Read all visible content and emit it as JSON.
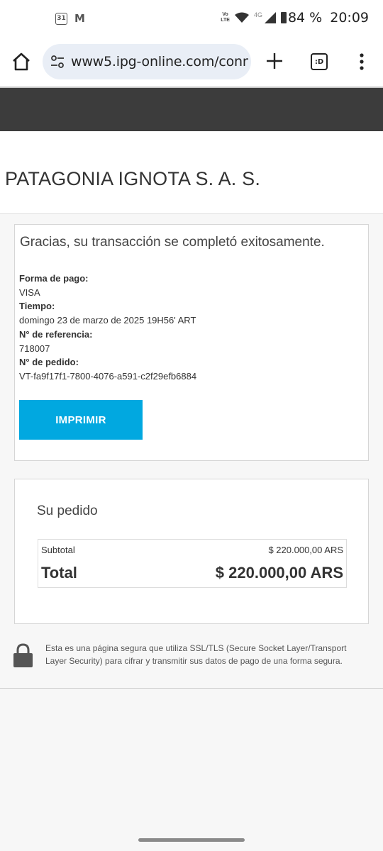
{
  "status_bar": {
    "calendar_day": "31",
    "mail_glyph": "M",
    "volte_top": "Vo",
    "volte_bottom": "LTE",
    "network": "4G",
    "battery": "84 %",
    "time": "20:09"
  },
  "browser": {
    "url": "www5.ipg-online.com/conn",
    "tab_count_label": ":D"
  },
  "merchant": {
    "name": "PATAGONIA IGNOTA S. A. S."
  },
  "confirmation": {
    "message": "Gracias, su transacción se completó exitosamente.",
    "payment_method_label": "Forma de pago:",
    "payment_method": "VISA",
    "time_label": "Tiempo:",
    "time": "domingo 23 de marzo de 2025 19H56' ART",
    "reference_label": "N° de referencia:",
    "reference": "718007",
    "order_label": "N° de pedido:",
    "order_id": "VT-fa9f17f1-7800-4076-a591-c2f29efb6884",
    "print_label": "IMPRIMIR"
  },
  "order": {
    "title": "Su pedido",
    "subtotal_label": "Subtotal",
    "subtotal": "$ 220.000,00 ARS",
    "total_label": "Total",
    "total": "$ 220.000,00 ARS"
  },
  "security": {
    "notice": "Esta es una página segura que utiliza SSL/TLS (Secure Socket Layer/Transport Layer Security) para cifrar y transmitir sus datos de pago de una forma segura."
  },
  "colors": {
    "accent": "#01a8e0",
    "header_dark": "#3c3c3c"
  }
}
